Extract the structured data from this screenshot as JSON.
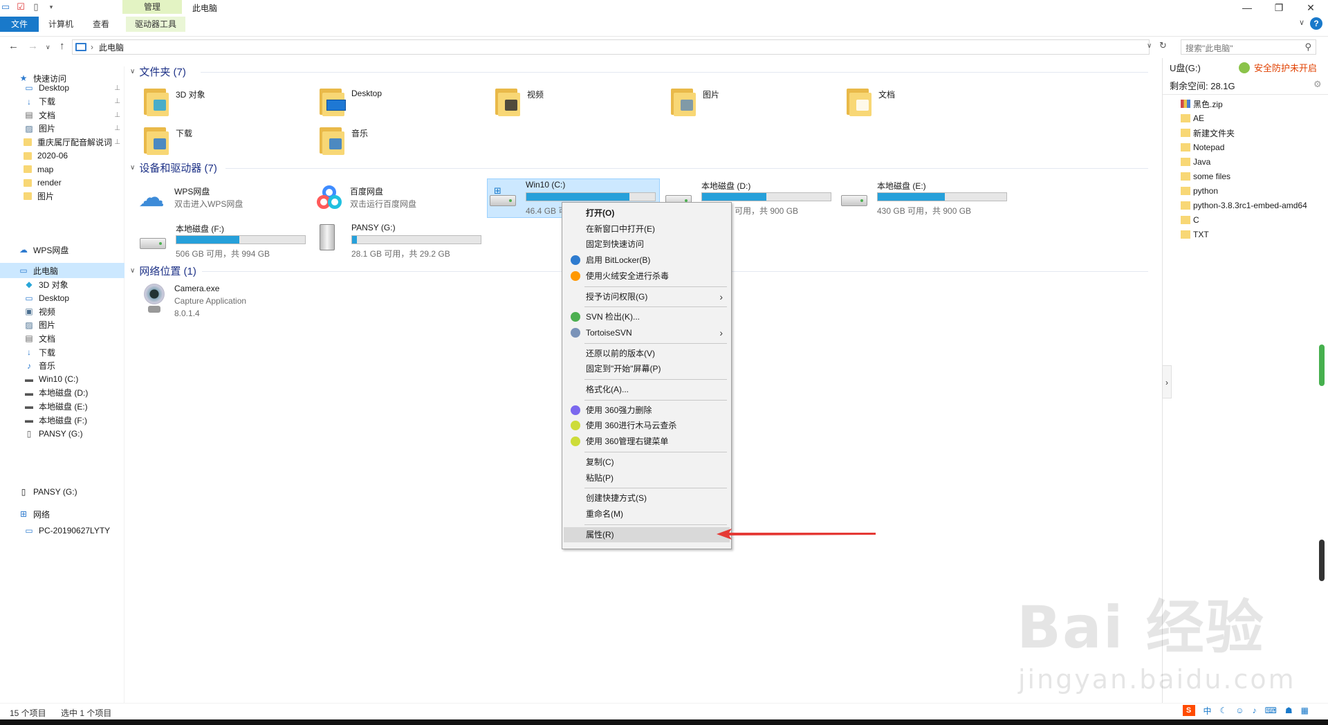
{
  "window": {
    "context_group": "管理",
    "title": "此电脑",
    "tabs": [
      "文件",
      "计算机",
      "查看",
      "驱动器工具"
    ]
  },
  "address": {
    "path": "此电脑",
    "search_placeholder": "搜索\"此电脑\""
  },
  "nav": {
    "quick_access": "快速访问",
    "items": [
      {
        "label": "Desktop",
        "icon": "desktop-icon",
        "pinned": true
      },
      {
        "label": "下载",
        "icon": "download-icon",
        "pinned": true
      },
      {
        "label": "文档",
        "icon": "document-icon",
        "pinned": true
      },
      {
        "label": "图片",
        "icon": "picture-icon",
        "pinned": true
      },
      {
        "label": "重庆属厅配音解说词",
        "icon": "folder-icon",
        "pinned": true
      },
      {
        "label": "2020-06",
        "icon": "folder-icon"
      },
      {
        "label": "map",
        "icon": "folder-icon"
      },
      {
        "label": "render",
        "icon": "folder-icon"
      },
      {
        "label": "图片",
        "icon": "folder-icon"
      }
    ],
    "wps": "WPS网盘",
    "this_pc": "此电脑",
    "pc_items": [
      {
        "label": "3D 对象",
        "icon": "3d-objects-icon"
      },
      {
        "label": "Desktop",
        "icon": "desktop-icon"
      },
      {
        "label": "视频",
        "icon": "video-icon"
      },
      {
        "label": "图片",
        "icon": "picture-icon"
      },
      {
        "label": "文档",
        "icon": "document-icon"
      },
      {
        "label": "下载",
        "icon": "download-icon"
      },
      {
        "label": "音乐",
        "icon": "music-icon"
      },
      {
        "label": "Win10 (C:)",
        "icon": "drive-icon"
      },
      {
        "label": "本地磁盘 (D:)",
        "icon": "drive-icon"
      },
      {
        "label": "本地磁盘 (E:)",
        "icon": "drive-icon"
      },
      {
        "label": "本地磁盘 (F:)",
        "icon": "drive-icon"
      },
      {
        "label": "PANSY (G:)",
        "icon": "usb-icon"
      }
    ],
    "pansy": "PANSY (G:)",
    "network": "网络",
    "network_pc": "PC-20190627LYTY"
  },
  "content": {
    "folders_header": "文件夹 (7)",
    "folders": [
      "3D 对象",
      "Desktop",
      "视频",
      "图片",
      "文档",
      "下载",
      "音乐"
    ],
    "devices_header": "设备和驱动器 (7)",
    "wps_name": "WPS网盘",
    "wps_sub": "双击进入WPS网盘",
    "baidu_name": "百度网盘",
    "baidu_sub": "双击运行百度网盘",
    "drives": [
      {
        "name": "Win10 (C:)",
        "space": "46.4 GB 可",
        "used": 0.8
      },
      {
        "name": "本地磁盘 (D:)",
        "space": "可用，共 900 GB",
        "used": 0.5
      },
      {
        "name": "本地磁盘 (E:)",
        "space": "430 GB 可用，共 900 GB",
        "used": 0.52
      },
      {
        "name": "本地磁盘 (F:)",
        "space": "506 GB 可用，共 994 GB",
        "used": 0.49
      },
      {
        "name": "PANSY (G:)",
        "space": "28.1 GB 可用，共 29.2 GB",
        "used": 0.04
      }
    ],
    "network_header": "网络位置 (1)",
    "camera_name": "Camera.exe",
    "camera_sub1": "Capture Application",
    "camera_sub2": "8.0.1.4"
  },
  "menu": {
    "items": [
      {
        "label": "打开(O)",
        "bold": true
      },
      {
        "label": "在新窗口中打开(E)"
      },
      {
        "label": "固定到快速访问"
      },
      {
        "label": "启用 BitLocker(B)",
        "icon": "bitlocker-shield-icon"
      },
      {
        "label": "使用火绒安全进行杀毒",
        "icon": "huorong-icon"
      },
      {
        "label": "授予访问权限(G)",
        "submenu": true
      },
      {
        "label": "SVN 检出(K)...",
        "icon": "svn-icon"
      },
      {
        "label": "TortoiseSVN",
        "icon": "tortoisesvn-icon",
        "submenu": true
      },
      {
        "label": "还原以前的版本(V)"
      },
      {
        "label": "固定到\"开始\"屏幕(P)"
      },
      {
        "label": "格式化(A)..."
      },
      {
        "label": "使用 360强力删除",
        "icon": "360-delete-icon"
      },
      {
        "label": "使用 360进行木马云查杀",
        "icon": "360-scan-icon"
      },
      {
        "label": "使用 360管理右键菜单",
        "icon": "360-menu-icon"
      },
      {
        "label": "复制(C)"
      },
      {
        "label": "粘贴(P)"
      },
      {
        "label": "创建快捷方式(S)"
      },
      {
        "label": "重命名(M)"
      },
      {
        "label": "属性(R)",
        "highlighted": true
      }
    ]
  },
  "right_pane": {
    "drive": "U盘(G:)",
    "warning": "安全防护未开启",
    "free": "剩余空间: 28.1G",
    "files": [
      "黑色.zip",
      "AE",
      "新建文件夹",
      "Notepad",
      "Java",
      "some files",
      "python",
      "python-3.8.3rc1-embed-amd64",
      "C",
      "TXT"
    ]
  },
  "status": {
    "count": "15 个项目",
    "selected": "选中 1 个项目"
  },
  "tray": {
    "ime": "中"
  },
  "watermark": {
    "brand": "Bai 经验",
    "url": "jingyan.baidu.com"
  },
  "colors": {
    "accent": "#1979ca",
    "selection": "#cce8ff",
    "bar_fill": "#26a0da",
    "arrow": "#e53935"
  }
}
